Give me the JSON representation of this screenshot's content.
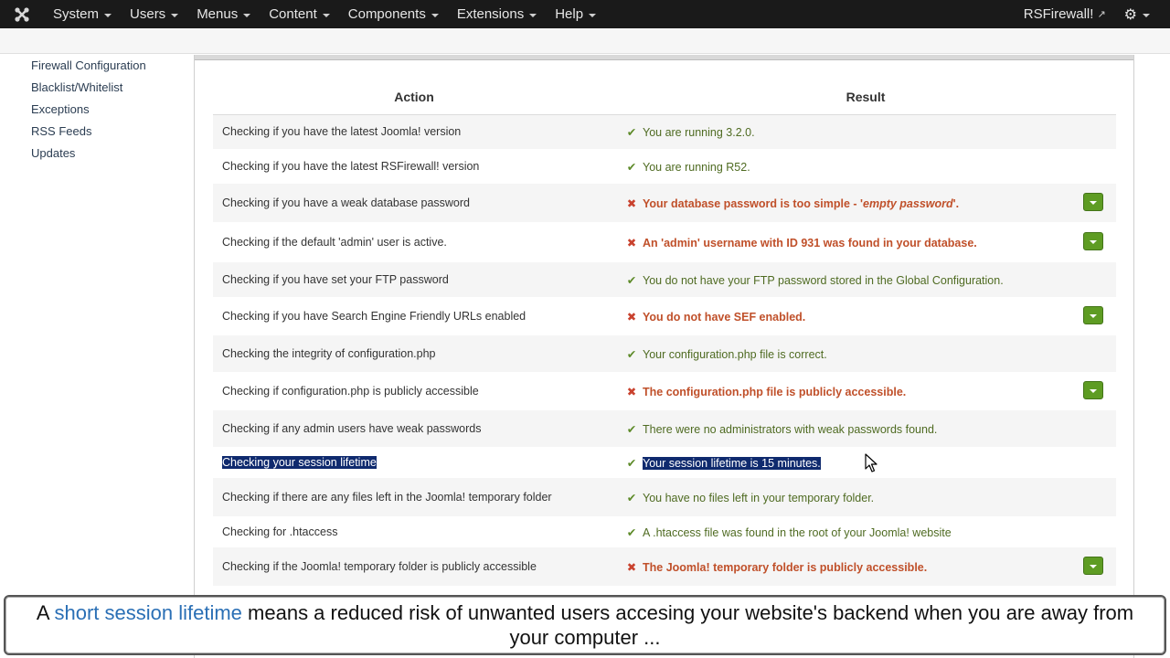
{
  "navbar": {
    "menus": [
      "System",
      "Users",
      "Menus",
      "Content",
      "Components",
      "Extensions",
      "Help"
    ],
    "site_link": "RSFirewall!",
    "colors": {
      "background": "#1a1a1a",
      "text": "#e6e6e6"
    }
  },
  "sidebar": {
    "items": [
      "Firewall Configuration",
      "Blacklist/Whitelist",
      "Exceptions",
      "RSS Feeds",
      "Updates"
    ]
  },
  "table": {
    "headers": {
      "action": "Action",
      "result": "Result"
    },
    "rows": [
      {
        "action": "Checking if you have the latest Joomla! version",
        "status": "ok",
        "result": "You are running 3.2.0.",
        "fix_button": false
      },
      {
        "action": "Checking if you have the latest RSFirewall! version",
        "status": "ok",
        "result": "You are running R52.",
        "fix_button": false
      },
      {
        "action": "Checking if you have a weak database password",
        "status": "bad",
        "result": "Your database password is too simple - '",
        "result_em": "empty password",
        "result_tail": "'.",
        "fix_button": true
      },
      {
        "action": "Checking if the default 'admin' user is active.",
        "status": "bad",
        "result": "An 'admin' username with ID 931 was found in your database.",
        "fix_button": true
      },
      {
        "action": "Checking if you have set your FTP password",
        "status": "ok",
        "result": "You do not have your FTP password stored in the Global Configuration.",
        "fix_button": false
      },
      {
        "action": "Checking if you have Search Engine Friendly URLs enabled",
        "status": "bad",
        "result": "You do not have SEF enabled.",
        "fix_button": true
      },
      {
        "action": "Checking the integrity of configuration.php",
        "status": "ok",
        "result": "Your configuration.php file is correct.",
        "fix_button": false
      },
      {
        "action": "Checking if configuration.php is publicly accessible",
        "status": "bad",
        "result": "The configuration.php file is publicly accessible.",
        "fix_button": true
      },
      {
        "action": "Checking if any admin users have weak passwords",
        "status": "ok",
        "result": "There were no administrators with weak passwords found.",
        "fix_button": false
      },
      {
        "action": "Checking your session lifetime",
        "status": "ok",
        "result": "Your session lifetime is 15 minutes.",
        "fix_button": false,
        "selected": true
      },
      {
        "action": "Checking if there are any files left in the Joomla! temporary folder",
        "status": "ok",
        "result": "You have no files left in your temporary folder.",
        "fix_button": false
      },
      {
        "action": "Checking for .htaccess",
        "status": "ok",
        "result": "A .htaccess file was found in the root of your Joomla! website",
        "fix_button": false
      },
      {
        "action": "Checking if the Joomla! temporary folder is publicly accessible",
        "status": "bad",
        "result": "The Joomla! temporary folder is publicly accessible.",
        "fix_button": true
      }
    ],
    "colors": {
      "ok": "#4f6b22",
      "bad": "#c0502a",
      "fix_button": "#5e9c23",
      "selection": "#0f2a6e"
    }
  },
  "caption": {
    "prefix": "A ",
    "highlight": "short session lifetime",
    "suffix": " means a reduced risk of unwanted users accesing your website's backend when you are away from your computer ...",
    "highlight_color": "#2a6fb5"
  },
  "icons": {
    "logo": "joomla-logo-icon",
    "external": "external-link-icon",
    "settings": "gear-icon",
    "ok": "checkmark-icon",
    "bad": "cross-icon",
    "dropdown": "caret-down-icon"
  }
}
